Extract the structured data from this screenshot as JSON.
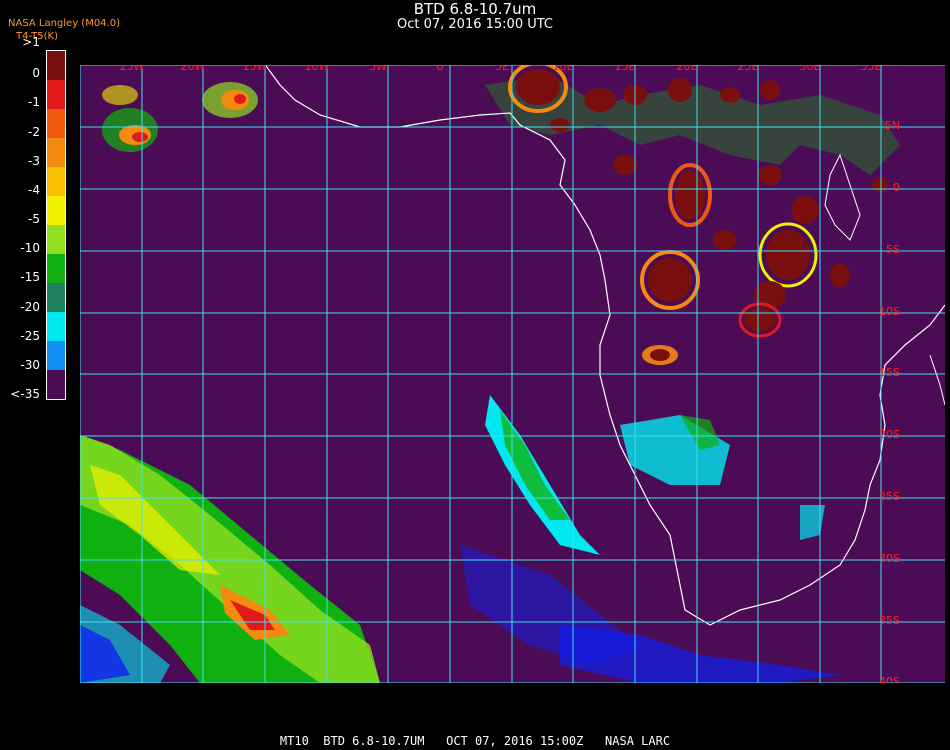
{
  "header": {
    "title": "BTD 6.8-10.7um",
    "subtitle": "Oct 07, 2016 15:00 UTC",
    "legend_source": "NASA Langley (M04.0)",
    "legend_product": "BTD",
    "legend_units": "T4-T5(K)"
  },
  "colorbar": {
    "labels": [
      ">1",
      "0",
      "-1",
      "-2",
      "-3",
      "-4",
      "-5",
      "-10",
      "-15",
      "-20",
      "-25",
      "-30",
      "<-35"
    ],
    "colors": [
      "#7a0f0f",
      "#e01a1a",
      "#f05a10",
      "#f58a10",
      "#f8c000",
      "#f0f000",
      "#90e020",
      "#10b010",
      "#208060",
      "#00e8f0",
      "#1090f0",
      "#1020f0",
      "#4b0c55"
    ]
  },
  "map": {
    "lon_labels": [
      "25W",
      "20W",
      "15W",
      "10W",
      "5W",
      "0",
      "5E",
      "10E",
      "15E",
      "20E",
      "25E",
      "30E",
      "35E"
    ],
    "lat_labels": [
      "5N",
      "0",
      "5S",
      "10S",
      "15S",
      "20S",
      "25S",
      "30S",
      "35S",
      "40S"
    ],
    "background": "#4b0c55",
    "grid_color": "#40e0f0",
    "label_color": "#ff2020"
  },
  "footer": {
    "text": "MT10  BTD 6.8-10.7UM   OCT 07, 2016 15:00Z   NASA LARC"
  }
}
